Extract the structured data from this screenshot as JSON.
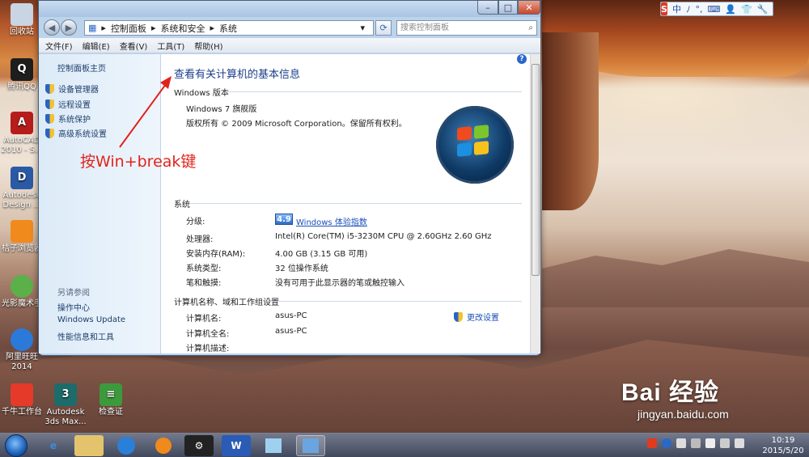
{
  "desktop_icons": [
    {
      "label": "回收站",
      "icon": "recycle-bin-icon",
      "color": "#c9d5e2"
    },
    {
      "label": "腾讯QQ",
      "icon": "qq-icon",
      "color": "#1e1e1e"
    },
    {
      "label": "AutoCAD 2010 - S...",
      "icon": "autocad-icon",
      "color": "#b71c1c"
    },
    {
      "label": "Autodesk Design ...",
      "icon": "autodesk-icon",
      "color": "#2a5aa6"
    },
    {
      "label": "桔子浏览器",
      "icon": "orange-browser-icon",
      "color": "#f08a1c"
    },
    {
      "label": "光影魔术手",
      "icon": "photo-tool-icon",
      "color": "#5bb04a"
    },
    {
      "label": "阿里旺旺 2014",
      "icon": "aliwangwang-icon",
      "color": "#2b7ad9"
    },
    {
      "label": "千牛工作台",
      "icon": "qianniu-icon",
      "color": "#e53a2a"
    },
    {
      "label": "Autodesk 3ds Max...",
      "icon": "3dsmax-icon",
      "color": "#1d6b6b"
    },
    {
      "label": "检查证",
      "icon": "document-icon",
      "color": "#3c9a3c"
    }
  ],
  "window": {
    "breadcrumb": [
      "控制面板",
      "系统和安全",
      "系统"
    ],
    "search_placeholder": "搜索控制面板",
    "menu": [
      "文件(F)",
      "编辑(E)",
      "查看(V)",
      "工具(T)",
      "帮助(H)"
    ],
    "sidebar": {
      "home": "控制面板主页",
      "links": [
        "设备管理器",
        "远程设置",
        "系统保护",
        "高级系统设置"
      ],
      "see_also_title": "另请参阅",
      "see_also": [
        "操作中心",
        "Windows Update",
        "性能信息和工具"
      ]
    },
    "content": {
      "title": "查看有关计算机的基本信息",
      "edition_header": "Windows 版本",
      "edition": "Windows 7 旗舰版",
      "copyright": "版权所有 © 2009 Microsoft Corporation。保留所有权利。",
      "system_header": "系统",
      "rating_label": "分级:",
      "rating_value": "4.9",
      "rating_link": "Windows 体验指数",
      "processor_label": "处理器:",
      "processor_value": "Intel(R) Core(TM) i5-3230M CPU @ 2.60GHz   2.60 GHz",
      "ram_label": "安装内存(RAM):",
      "ram_value": "4.00 GB (3.15 GB 可用)",
      "type_label": "系统类型:",
      "type_value": "32 位操作系统",
      "pen_label": "笔和触摸:",
      "pen_value": "没有可用于此显示器的笔或触控输入",
      "computer_header": "计算机名称、域和工作组设置",
      "name_label": "计算机名:",
      "name_value": "asus-PC",
      "fullname_label": "计算机全名:",
      "fullname_value": "asus-PC",
      "desc_label": "计算机描述:",
      "change_settings": "更改设置"
    }
  },
  "annotation": {
    "text": "按Win+break键",
    "color": "#e2231a"
  },
  "ime_bar": {
    "items": [
      "中",
      "ﾉ",
      "°,",
      "⌨",
      "👤",
      "👕",
      "🔧"
    ]
  },
  "taskbar": {
    "clock_time": "10:19",
    "clock_date": "2015/5/20",
    "buttons": [
      "explorer-icon",
      "ie-icon",
      "sogou-icon",
      "orange-browser-icon",
      "app-icon",
      "wps-icon",
      "notepad-icon",
      "control-panel-icon"
    ]
  },
  "watermark": {
    "brand": "Bai 经验",
    "site": "jingyan.baidu.com"
  }
}
